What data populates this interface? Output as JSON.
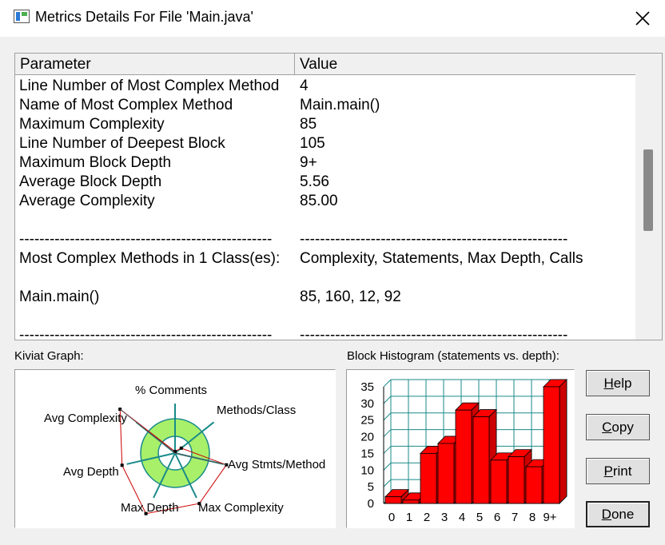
{
  "window": {
    "title": "Metrics Details For File 'Main.java'"
  },
  "table": {
    "headers": [
      "Parameter",
      "Value"
    ],
    "rows": [
      [
        "Line Number of Most Complex Method",
        "4"
      ],
      [
        "Name of Most Complex Method",
        "Main.main()"
      ],
      [
        "Maximum Complexity",
        "85"
      ],
      [
        "Line Number of Deepest Block",
        "105"
      ],
      [
        "Maximum Block Depth",
        "9+"
      ],
      [
        "Average Block Depth",
        "5.56"
      ],
      [
        "Average Complexity",
        "85.00"
      ],
      [
        "",
        ""
      ],
      [
        "--------------------------------------------------",
        "-----------------------------------------------------"
      ],
      [
        "Most Complex Methods in 1 Class(es):",
        "Complexity, Statements, Max Depth, Calls"
      ],
      [
        "",
        ""
      ],
      [
        "Main.main()",
        "85, 160, 12, 92"
      ],
      [
        "",
        ""
      ],
      [
        "--------------------------------------------------",
        "-----------------------------------------------------"
      ]
    ]
  },
  "kiviat": {
    "caption": "Kiviat Graph:",
    "axes": [
      "% Comments",
      "Methods/Class",
      "Avg Stmts/Method",
      "Max Complexity",
      "Max Depth",
      "Avg Depth",
      "Avg Complexity"
    ]
  },
  "histogram": {
    "caption": "Block Histogram (statements vs. depth):",
    "y_ticks": [
      "35",
      "30",
      "25",
      "20",
      "15",
      "10",
      "5",
      "0"
    ],
    "x_labels": [
      "0",
      "1",
      "2",
      "3",
      "4",
      "5",
      "6",
      "7",
      "8",
      "9+"
    ],
    "values": [
      2,
      1,
      15,
      18,
      28,
      26,
      13,
      14,
      11,
      35
    ],
    "ylim": [
      0,
      35
    ],
    "bar_color": "#ff0000"
  },
  "buttons": [
    {
      "pre": "",
      "u": "H",
      "post": "elp"
    },
    {
      "pre": "",
      "u": "C",
      "post": "opy"
    },
    {
      "pre": "",
      "u": "P",
      "post": "rint"
    },
    {
      "pre": "",
      "u": "D",
      "post": "one"
    }
  ],
  "colors": {
    "ring_fill": "#a8f06a",
    "ring_stroke": "#1a8a8a",
    "polygon": "#cc0000"
  }
}
